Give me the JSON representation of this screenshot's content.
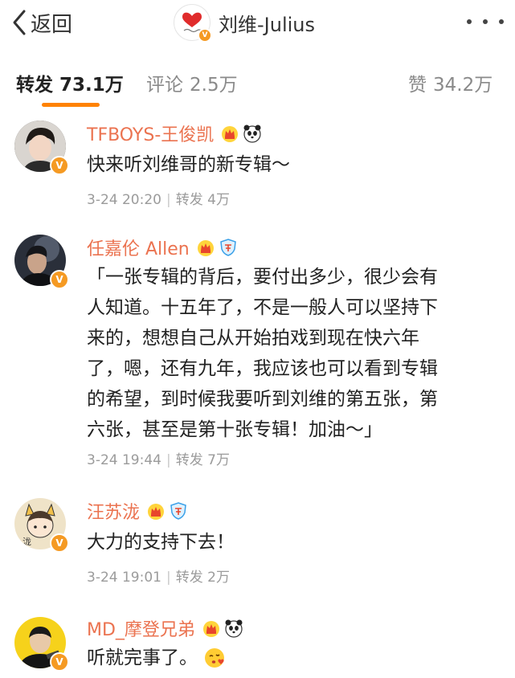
{
  "nav": {
    "back_label": "返回",
    "title": "刘维-Julius"
  },
  "tabs": [
    {
      "label": "转发",
      "count": "73.1万",
      "active": true
    },
    {
      "label": "评论",
      "count": "2.5万",
      "active": false
    },
    {
      "label": "赞",
      "count": "34.2万",
      "active": false
    }
  ],
  "reposts": [
    {
      "name": "TFBOYS-王俊凯",
      "badges": [
        "crown-icon",
        "panda-icon"
      ],
      "text": "快来听刘维哥的新专辑～",
      "time": "3-24 20:20",
      "repost_label": "转发",
      "repost_count": "4万"
    },
    {
      "name": "任嘉伦 Allen",
      "badges": [
        "crown-icon",
        "shield-icon"
      ],
      "text_lines": [
        "「一张专辑的背后，要付出多少，很少会有",
        "人知道。十五年了，不是一般人可以坚持下",
        "来的，想想自己从开始拍戏到现在快六年",
        "了，嗯，还有九年，我应该也可以看到专辑",
        "的希望，到时候我要听到刘维的第五张，第",
        "六张，甚至是第十张专辑！加油～」"
      ],
      "time": "3-24 19:44",
      "repost_label": "转发",
      "repost_count": "7万"
    },
    {
      "name": "汪苏泷",
      "badges": [
        "crown-icon",
        "shield-icon"
      ],
      "text": "大力的支持下去！",
      "time": "3-24 19:01",
      "repost_label": "转发",
      "repost_count": "2万"
    },
    {
      "name": "MD_摩登兄弟",
      "badges": [
        "crown-icon",
        "panda-icon"
      ],
      "text": "听就完事了。",
      "emoji": "kiss-emoji-icon"
    }
  ],
  "colors": {
    "accent": "#ff8200",
    "username": "#eb7350",
    "verified": "#f59a23",
    "meta": "#9b9b9b"
  }
}
